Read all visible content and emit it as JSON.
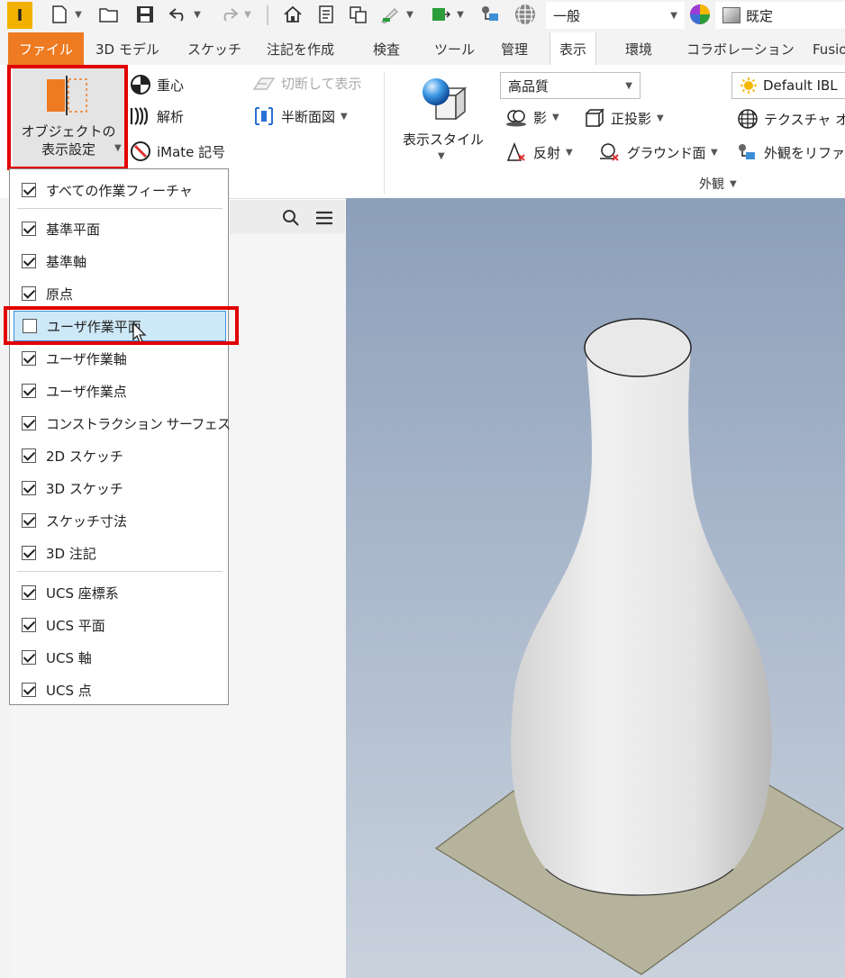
{
  "app": {
    "logo_letter": "I"
  },
  "quick_access": {
    "style_combo": "一般",
    "material_combo": "既定"
  },
  "tabs": [
    {
      "label": "ファイル"
    },
    {
      "label": "3D モデル"
    },
    {
      "label": "スケッチ"
    },
    {
      "label": "注記を作成"
    },
    {
      "label": "検査"
    },
    {
      "label": "ツール"
    },
    {
      "label": "管理"
    },
    {
      "label": "表示"
    },
    {
      "label": "環境"
    },
    {
      "label": "コラボレーション"
    },
    {
      "label": "Fusio"
    }
  ],
  "ribbon": {
    "object_visibility": "オブジェクトの\n表示設定",
    "center_of_gravity": "重心",
    "analysis": "解析",
    "imate_symbol": "iMate 記号",
    "cut_display": "切断して表示",
    "half_section": "半断面図",
    "visual_style": "表示スタイル",
    "quality_combo": "高品質",
    "shadow": "影",
    "orthographic": "正投影",
    "reflection": "反射",
    "ground_plane": "グラウンド面",
    "ibl_combo": "Default IBL",
    "texture": "テクスチャ オ",
    "appearance_ref": "外観をリファ",
    "appearance_panel": "外観"
  },
  "dropdown": {
    "items": [
      {
        "label": "すべての作業フィーチャ",
        "checked": true
      },
      {
        "label": "基準平面",
        "checked": true
      },
      {
        "label": "基準軸",
        "checked": true
      },
      {
        "label": "原点",
        "checked": true
      },
      {
        "label": "ユーザ作業平面",
        "checked": false
      },
      {
        "label": "ユーザ作業軸",
        "checked": true
      },
      {
        "label": "ユーザ作業点",
        "checked": true
      },
      {
        "label": "コンストラクション サーフェス",
        "checked": true
      },
      {
        "label": "2D スケッチ",
        "checked": true
      },
      {
        "label": "3D スケッチ",
        "checked": true
      },
      {
        "label": "スケッチ寸法",
        "checked": true
      },
      {
        "label": "3D 注記",
        "checked": true
      },
      {
        "label": "UCS 座標系",
        "checked": true
      },
      {
        "label": "UCS 平面",
        "checked": true
      },
      {
        "label": "UCS 軸",
        "checked": true
      },
      {
        "label": "UCS 点",
        "checked": true
      }
    ]
  },
  "colors": {
    "accent_orange": "#ee7b22",
    "highlight_red": "#e10000",
    "selection_blue": "#3c8fd6"
  }
}
